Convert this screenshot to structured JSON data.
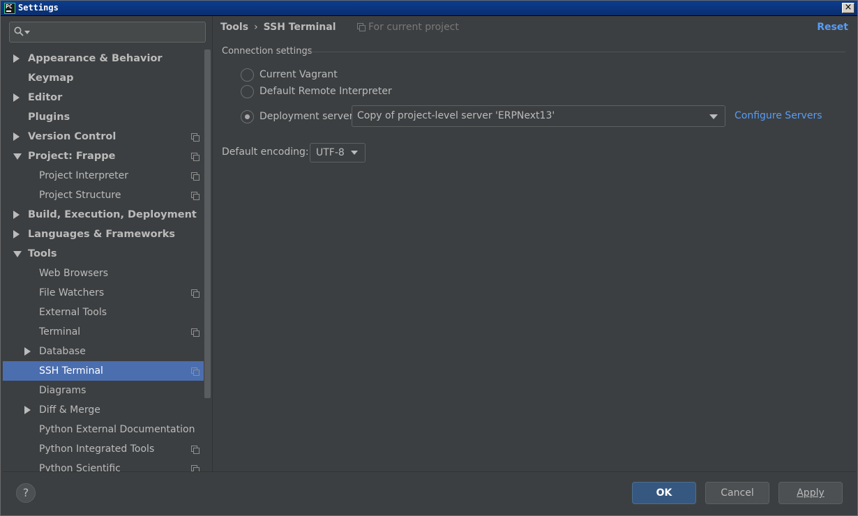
{
  "window": {
    "title": "Settings",
    "app_icon_text": "PC"
  },
  "search": {
    "value": ""
  },
  "tree": [
    {
      "label": "Appearance & Behavior",
      "level": 0,
      "arrow": "right",
      "proj": false
    },
    {
      "label": "Keymap",
      "level": 0,
      "arrow": "",
      "proj": false
    },
    {
      "label": "Editor",
      "level": 0,
      "arrow": "right",
      "proj": false
    },
    {
      "label": "Plugins",
      "level": 0,
      "arrow": "",
      "proj": false
    },
    {
      "label": "Version Control",
      "level": 0,
      "arrow": "right",
      "proj": true
    },
    {
      "label": "Project: Frappe",
      "level": 0,
      "arrow": "down",
      "proj": true
    },
    {
      "label": "Project Interpreter",
      "level": 1,
      "arrow": "",
      "proj": true
    },
    {
      "label": "Project Structure",
      "level": 1,
      "arrow": "",
      "proj": true
    },
    {
      "label": "Build, Execution, Deployment",
      "level": 0,
      "arrow": "right",
      "proj": false
    },
    {
      "label": "Languages & Frameworks",
      "level": 0,
      "arrow": "right",
      "proj": false
    },
    {
      "label": "Tools",
      "level": 0,
      "arrow": "down",
      "proj": false
    },
    {
      "label": "Web Browsers",
      "level": 1,
      "arrow": "",
      "proj": false
    },
    {
      "label": "File Watchers",
      "level": 1,
      "arrow": "",
      "proj": true
    },
    {
      "label": "External Tools",
      "level": 1,
      "arrow": "",
      "proj": false
    },
    {
      "label": "Terminal",
      "level": 1,
      "arrow": "",
      "proj": true
    },
    {
      "label": "Database",
      "level": 1,
      "arrow": "right",
      "proj": false
    },
    {
      "label": "SSH Terminal",
      "level": 1,
      "arrow": "",
      "proj": true,
      "selected": true
    },
    {
      "label": "Diagrams",
      "level": 1,
      "arrow": "",
      "proj": false
    },
    {
      "label": "Diff & Merge",
      "level": 1,
      "arrow": "right",
      "proj": false
    },
    {
      "label": "Python External Documentation",
      "level": 1,
      "arrow": "",
      "proj": false
    },
    {
      "label": "Python Integrated Tools",
      "level": 1,
      "arrow": "",
      "proj": true
    },
    {
      "label": "Python Scientific",
      "level": 1,
      "arrow": "",
      "proj": true
    }
  ],
  "header": {
    "crumb_parent": "Tools",
    "crumb_sep": "›",
    "crumb_current": "SSH Terminal",
    "for_project": "For current project",
    "reset": "Reset"
  },
  "connection": {
    "group_title": "Connection settings",
    "options": [
      {
        "label": "Current Vagrant",
        "checked": false
      },
      {
        "label": "Default Remote Interpreter",
        "checked": false
      },
      {
        "label": "Deployment server",
        "checked": true
      }
    ],
    "server_value": "Copy of project-level server 'ERPNext13'",
    "configure_link": "Configure Servers"
  },
  "encoding": {
    "label": "Default encoding:",
    "value": "UTF-8"
  },
  "buttons": {
    "help": "?",
    "ok": "OK",
    "cancel": "Cancel",
    "apply": "Apply"
  },
  "colors": {
    "accent": "#589df6",
    "selection": "#4b6eaf",
    "ok_button": "#365880",
    "background": "#3c3f41"
  }
}
